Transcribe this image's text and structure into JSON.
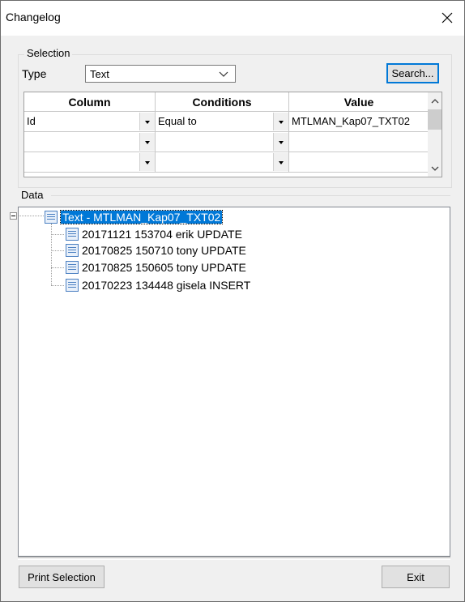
{
  "window": {
    "title": "Changelog"
  },
  "selection": {
    "group_label": "Selection",
    "type_label": "Type",
    "type_value": "Text",
    "search_button": "Search..."
  },
  "grid": {
    "headers": [
      "Column",
      "Conditions",
      "Value"
    ],
    "rows": [
      {
        "column": "Id",
        "condition": "Equal to",
        "value": "MTLMAN_Kap07_TXT02"
      },
      {
        "column": "",
        "condition": "",
        "value": ""
      },
      {
        "column": "",
        "condition": "",
        "value": ""
      }
    ]
  },
  "data": {
    "group_label": "Data",
    "root": "Text - MTLMAN_Kap07_TXT02",
    "children": [
      "20171121 153704 erik UPDATE",
      "20170825 150710 tony UPDATE",
      "20170825 150605 tony UPDATE",
      "20170223 134448 gisela INSERT"
    ]
  },
  "buttons": {
    "print_selection": "Print Selection",
    "exit": "Exit"
  }
}
